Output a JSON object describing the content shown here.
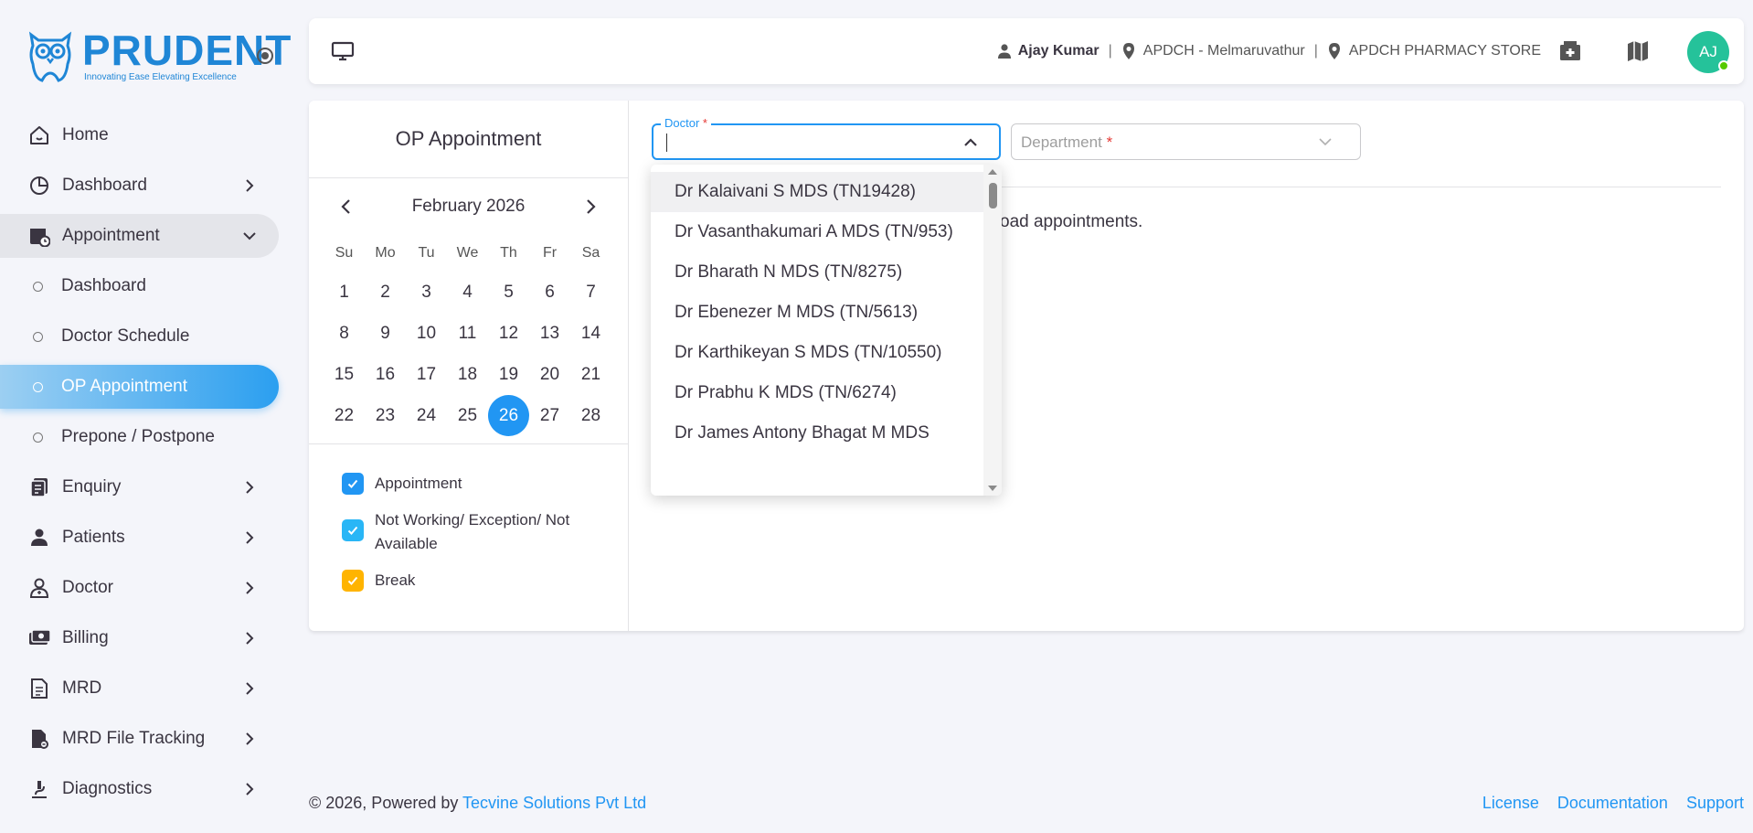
{
  "brand": {
    "name": "PRUDENT",
    "tagline": "Innovating Ease Elevating Excellence",
    "color": "#1f86d6"
  },
  "sidebar": {
    "items": [
      {
        "label": "Home",
        "icon": "home-icon"
      },
      {
        "label": "Dashboard",
        "icon": "pie-chart-icon"
      },
      {
        "label": "Appointment",
        "icon": "calendar-clock-icon",
        "expanded": true
      },
      {
        "label": "Enquiry",
        "icon": "enquiry-icon"
      },
      {
        "label": "Patients",
        "icon": "person-icon"
      },
      {
        "label": "Doctor",
        "icon": "doctor-icon"
      },
      {
        "label": "Billing",
        "icon": "billing-icon"
      },
      {
        "label": "MRD",
        "icon": "document-icon"
      },
      {
        "label": "MRD File Tracking",
        "icon": "file-tracking-icon"
      },
      {
        "label": "Diagnostics",
        "icon": "microscope-icon"
      }
    ],
    "appointment_sub": [
      {
        "label": "Dashboard"
      },
      {
        "label": "Doctor Schedule"
      },
      {
        "label": "OP Appointment",
        "active": true
      },
      {
        "label": "Prepone / Postpone"
      }
    ]
  },
  "topbar": {
    "user": "Ajay Kumar",
    "location": "APDCH - Melmaruvathur",
    "store": "APDCH PHARMACY STORE",
    "avatar_initials": "AJ",
    "avatar_color": "#25c29a"
  },
  "page": {
    "title": "OP Appointment"
  },
  "calendar": {
    "month_label": "February 2026",
    "weekdays": [
      "Su",
      "Mo",
      "Tu",
      "We",
      "Th",
      "Fr",
      "Sa"
    ],
    "weeks": [
      [
        "1",
        "2",
        "3",
        "4",
        "5",
        "6",
        "7"
      ],
      [
        "8",
        "9",
        "10",
        "11",
        "12",
        "13",
        "14"
      ],
      [
        "15",
        "16",
        "17",
        "18",
        "19",
        "20",
        "21"
      ],
      [
        "22",
        "23",
        "24",
        "25",
        "26",
        "27",
        "28"
      ]
    ],
    "selected": "26"
  },
  "legend": [
    {
      "label": "Appointment",
      "color": "#2196f3"
    },
    {
      "label": "Not Working/ Exception/ Not Available",
      "color": "#29b6f6"
    },
    {
      "label": "Break",
      "color": "#ffb400"
    }
  ],
  "filters": {
    "doctor_label": "Doctor",
    "doctor_value": "",
    "department_placeholder": "Department",
    "required_mark": "*"
  },
  "hint_text": "oad appointments.",
  "doctor_options": [
    "Dr Kalaivani S MDS (TN19428)",
    "Dr Vasanthakumari A MDS (TN/953)",
    "Dr Bharath N MDS (TN/8275)",
    "Dr Ebenezer M MDS (TN/5613)",
    "Dr Karthikeyan S MDS (TN/10550)",
    "Dr Prabhu K MDS (TN/6274)",
    "Dr James Antony Bhagat M MDS"
  ],
  "footer": {
    "copyright": "© 2026, Powered by ",
    "company": "Tecvine Solutions Pvt Ltd",
    "links": [
      "License",
      "Documentation",
      "Support"
    ]
  }
}
